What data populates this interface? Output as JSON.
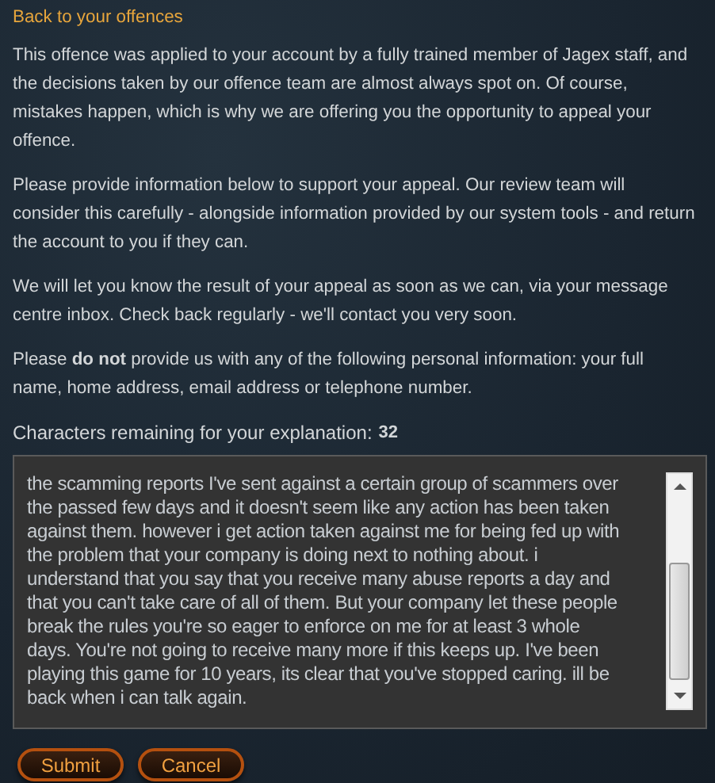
{
  "back_link": "Back to your offences",
  "paragraphs": [
    "This offence was applied to your account by a fully trained member of Jagex staff, and the decisions taken by our offence team are almost always spot on. Of course, mistakes happen, which is why we are offering you the opportunity to appeal your offence.",
    "Please provide information below to support your appeal. Our review team will consider this carefully - alongside information provided by our system tools - and return the account to you if they can.",
    "We will let you know the result of your appeal as soon as we can, via your message centre inbox. Check back regularly - we'll contact you very soon.",
    "Please **do not** provide us with any of the following personal information: your full name, home address, email address or telephone number."
  ],
  "counter": {
    "label": "Characters remaining for your explanation:",
    "value": "32"
  },
  "explanation": {
    "lines": [
      "the scamming reports I've sent against a certain group of scammers over",
      "the passed few days and it doesn't seem like any action has been taken",
      "against them. however i get action taken against me for being fed up with",
      "the problem that your company is doing next to nothing about. i",
      "understand that you say that you receive many abuse reports a day and",
      "that you can't take care of all of them. But your company let these people",
      "break the rules you're so eager to enforce on me for at least 3 whole",
      "days. You're not going to receive many more if this keeps up. I've been",
      "playing this game for 10 years, its clear that you've stopped caring. ill be",
      "back when i can talk again."
    ]
  },
  "buttons": [
    "Submit",
    "Cancel"
  ]
}
